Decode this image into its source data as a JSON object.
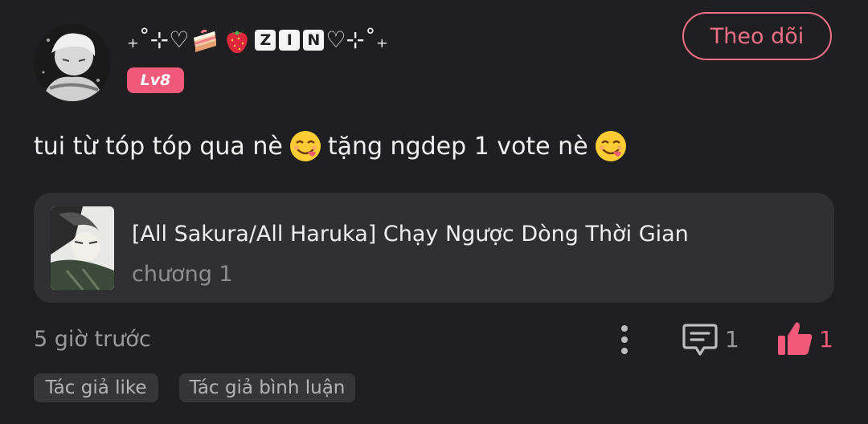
{
  "comment": {
    "username_prefix": "₊˚⊹♡",
    "username_letters": [
      "Z",
      "I",
      "N"
    ],
    "username_suffix": "♡⊹˚₊",
    "level": "Lv8",
    "follow_label": "Theo dõi",
    "text_part1": "tui từ tóp tóp qua nè",
    "text_part2": "tặng ngdep 1 vote nè",
    "timestamp": "5 giờ trước",
    "reply_count": "1",
    "like_count": "1"
  },
  "story": {
    "title": "[All Sakura/All Haruka] Chạy Ngược Dòng Thời Gian",
    "chapter": "chương 1"
  },
  "tags": [
    "Tác giả like",
    "Tác giả bình luận"
  ],
  "icons": {
    "avatar": "avatar",
    "cake": "cake-icon",
    "strawberry": "strawberry-icon",
    "emoji": "yum-face-icon",
    "more": "more-vertical-icon",
    "comment": "comment-icon",
    "like": "thumbs-up-icon"
  },
  "colors": {
    "background": "#1f1f21",
    "accent": "#f0597a",
    "follow_border": "#ef6f86",
    "card": "#303033",
    "muted": "#9a9a9e"
  }
}
